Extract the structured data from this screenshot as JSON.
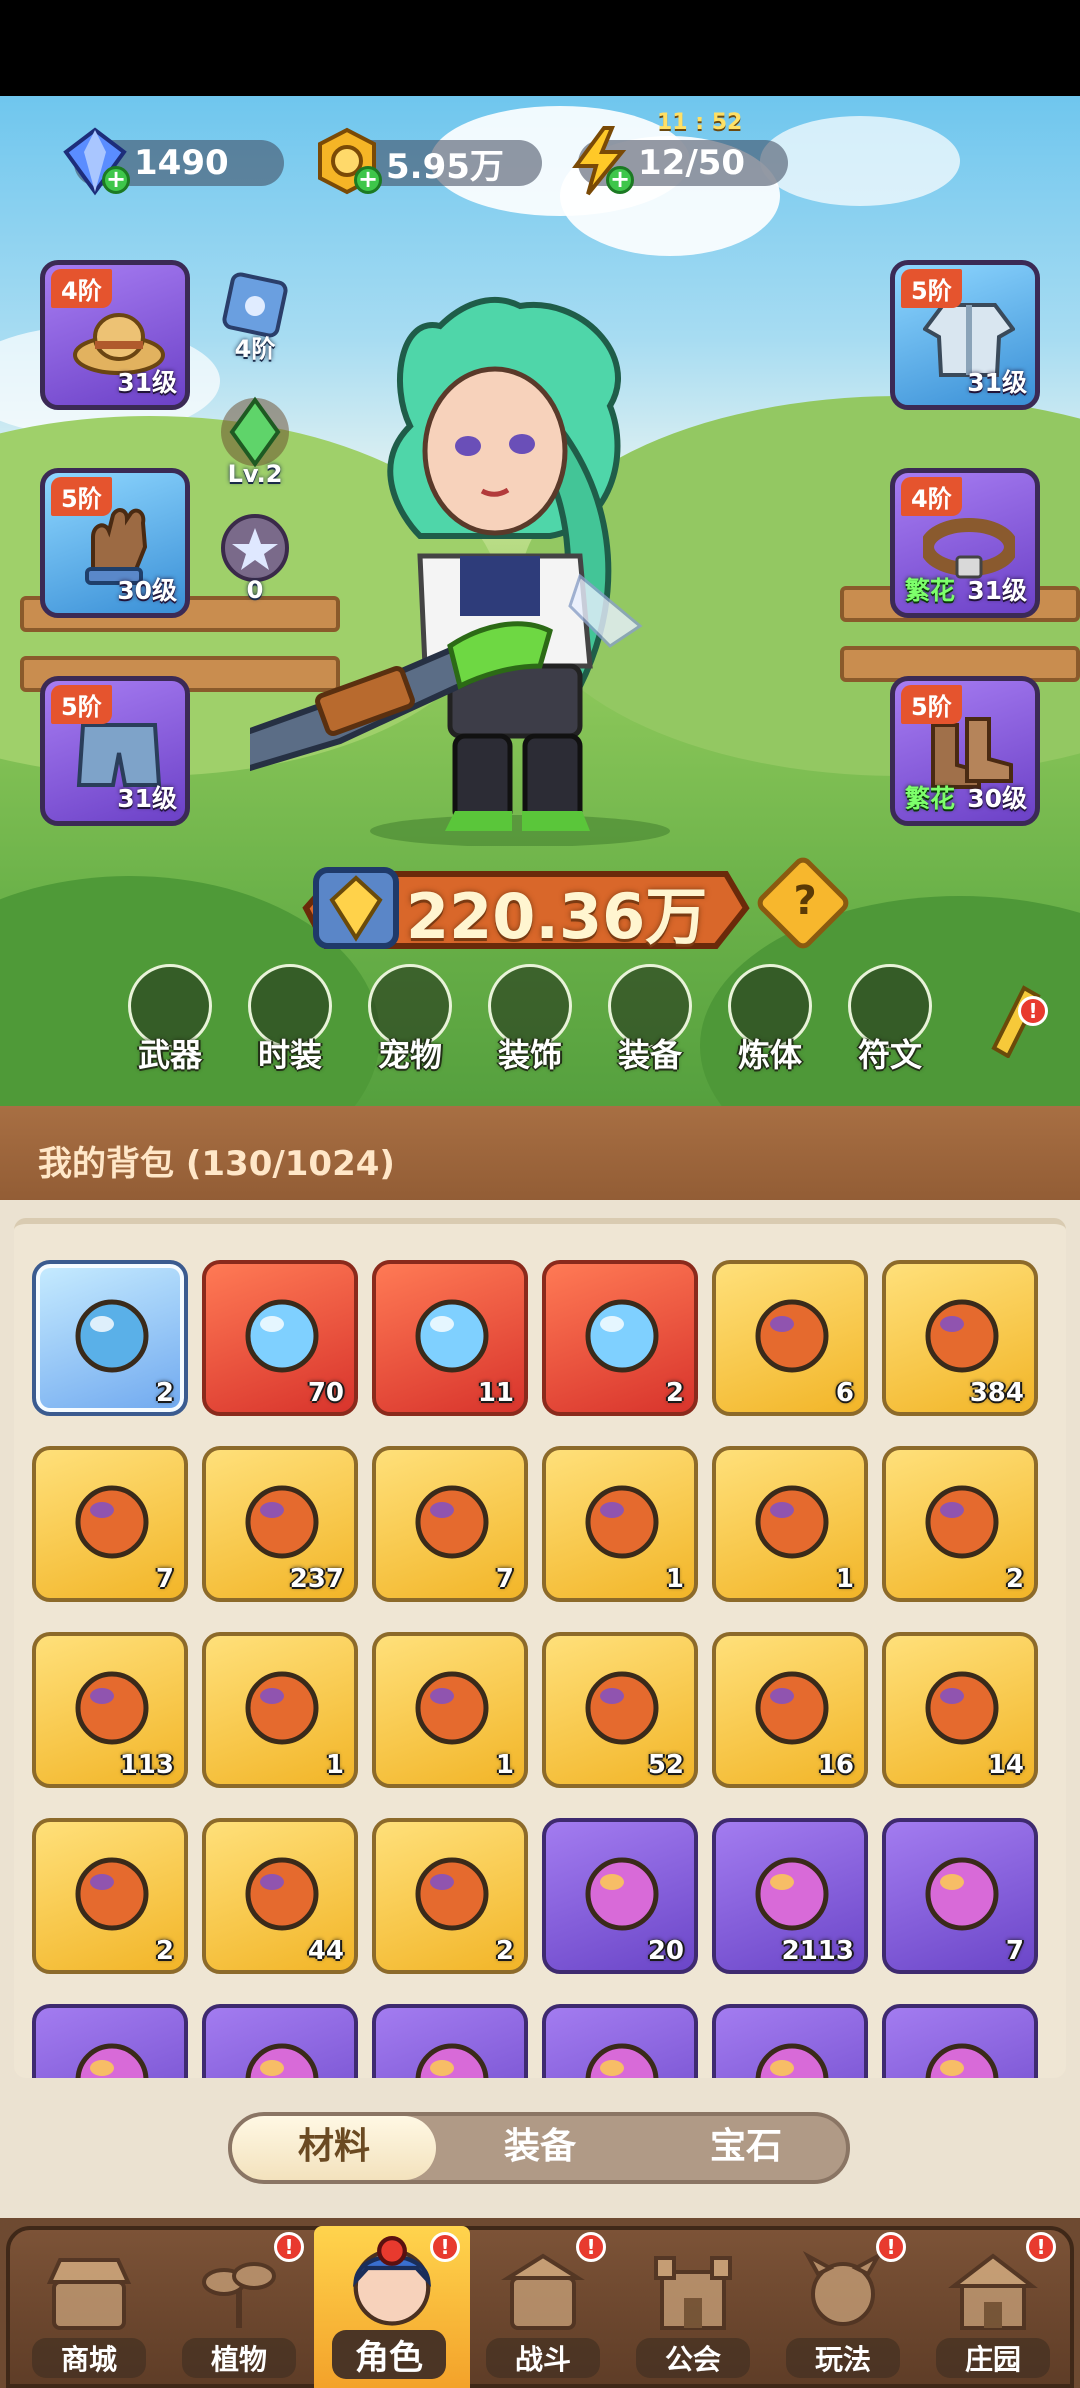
{
  "resources": [
    {
      "name": "diamond",
      "value": "1490",
      "icon": "diamond-icon"
    },
    {
      "name": "coin",
      "value": "5.95万",
      "icon": "gold-coin-icon"
    },
    {
      "name": "energy",
      "value": "12/50",
      "icon": "lightning-icon"
    }
  ],
  "energy_timer": "11 : 52",
  "equipment_left": [
    {
      "tier": "4阶",
      "level": "31级",
      "icon": "straw-hat-icon",
      "bloom": ""
    },
    {
      "tier": "5阶",
      "level": "30级",
      "icon": "glove-icon",
      "bloom": ""
    },
    {
      "tier": "5阶",
      "level": "31级",
      "icon": "shorts-icon",
      "bloom": ""
    }
  ],
  "equipment_right": [
    {
      "tier": "5阶",
      "level": "31级",
      "icon": "jacket-icon",
      "bloom": ""
    },
    {
      "tier": "4阶",
      "level": "31级",
      "icon": "belt-icon",
      "bloom": "繁花"
    },
    {
      "tier": "5阶",
      "level": "30级",
      "icon": "boots-icon",
      "bloom": "繁花"
    }
  ],
  "side_stats": [
    {
      "label": "4阶",
      "icon": "paw-shield-icon"
    },
    {
      "label": "Lv.2",
      "icon": "green-gem-icon"
    },
    {
      "label": "0",
      "icon": "star-orb-icon"
    }
  ],
  "power": "220.36万",
  "help_symbol": "?",
  "categories": [
    "武器",
    "时装",
    "宠物",
    "装饰",
    "装备",
    "炼体",
    "符文"
  ],
  "bag_title": "我的背包 (130/1024)",
  "items": [
    {
      "count": "2",
      "rarity": "blue",
      "icon": "orb-disc-icon"
    },
    {
      "count": "70",
      "rarity": "red",
      "icon": "blue-crystal-icon"
    },
    {
      "count": "11",
      "rarity": "red",
      "icon": "red-potion-icon"
    },
    {
      "count": "2",
      "rarity": "red",
      "icon": "green-canister-icon"
    },
    {
      "count": "6",
      "rarity": "gold",
      "icon": "skull-scroll-icon"
    },
    {
      "count": "384",
      "rarity": "gold",
      "icon": "honey-pot-icon"
    },
    {
      "count": "7",
      "rarity": "gold",
      "icon": "drone-icon"
    },
    {
      "count": "237",
      "rarity": "gold",
      "icon": "letter-tile-icon"
    },
    {
      "count": "7",
      "rarity": "gold",
      "icon": "mandrake-icon"
    },
    {
      "count": "1",
      "rarity": "gold",
      "icon": "key-icon"
    },
    {
      "count": "1",
      "rarity": "gold",
      "icon": "fire-crystal-icon"
    },
    {
      "count": "2",
      "rarity": "gold",
      "icon": "rune-stone-icon"
    },
    {
      "count": "113",
      "rarity": "gold",
      "icon": "orange-potion-icon"
    },
    {
      "count": "1",
      "rarity": "gold",
      "icon": "red-flower-icon"
    },
    {
      "count": "1",
      "rarity": "gold",
      "icon": "flower-pot-icon"
    },
    {
      "count": "52",
      "rarity": "gold",
      "icon": "spell-book-icon"
    },
    {
      "count": "16",
      "rarity": "gold",
      "icon": "canned-food-icon"
    },
    {
      "count": "14",
      "rarity": "gold",
      "icon": "card-icon"
    },
    {
      "count": "2",
      "rarity": "gold",
      "icon": "flower-badge-icon"
    },
    {
      "count": "44",
      "rarity": "gold",
      "icon": "lily-icon"
    },
    {
      "count": "2",
      "rarity": "gold",
      "icon": "grape-icon"
    },
    {
      "count": "20",
      "rarity": "purple",
      "icon": "purple-potion-icon"
    },
    {
      "count": "2113",
      "rarity": "purple",
      "icon": "apple-coin-icon"
    },
    {
      "count": "7",
      "rarity": "purple",
      "icon": "flashlight-icon"
    },
    {
      "count": "",
      "rarity": "purple",
      "icon": "teddy-bear-icon"
    },
    {
      "count": "",
      "rarity": "purple",
      "icon": "ring-icon"
    },
    {
      "count": "",
      "rarity": "purple",
      "icon": "shield-icon"
    },
    {
      "count": "",
      "rarity": "purple",
      "icon": "green-bag-icon"
    },
    {
      "count": "",
      "rarity": "purple",
      "icon": "candy-icon"
    },
    {
      "count": "",
      "rarity": "purple",
      "icon": "blue-gift-icon"
    }
  ],
  "bag_tabs": [
    {
      "label": "材料",
      "active": true
    },
    {
      "label": "装备",
      "active": false
    },
    {
      "label": "宝石",
      "active": false
    }
  ],
  "bottom_nav": [
    {
      "label": "商城",
      "icon": "shop-icon",
      "active": false,
      "badge": false
    },
    {
      "label": "植物",
      "icon": "plant-icon",
      "active": false,
      "badge": true
    },
    {
      "label": "角色",
      "icon": "character-icon",
      "active": true,
      "badge": true
    },
    {
      "label": "战斗",
      "icon": "battle-icon",
      "active": false,
      "badge": true
    },
    {
      "label": "公会",
      "icon": "guild-icon",
      "active": false,
      "badge": false
    },
    {
      "label": "玩法",
      "icon": "gameplay-icon",
      "active": false,
      "badge": true
    },
    {
      "label": "庄园",
      "icon": "manor-icon",
      "active": false,
      "badge": true
    }
  ],
  "colors": {
    "gold": "#f2b528",
    "red": "#d8342c",
    "purple": "#6b46c8",
    "blue": "#6fa8ef",
    "badge": "#e83a2e"
  }
}
